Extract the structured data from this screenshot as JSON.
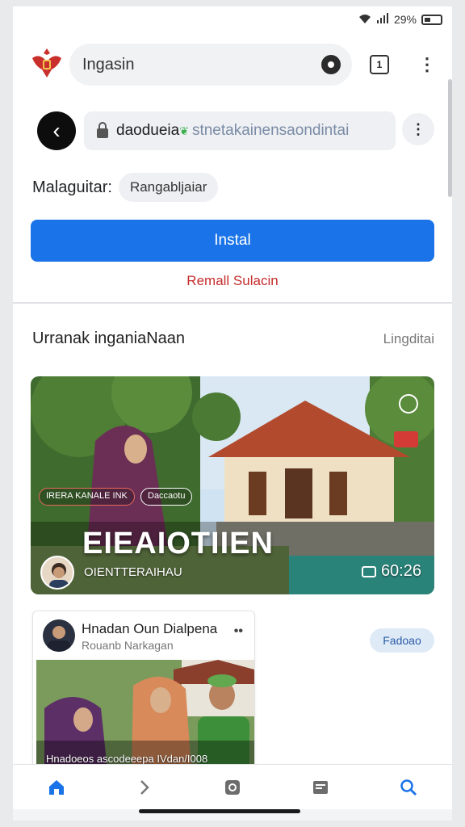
{
  "status_bar": {
    "battery": "29%"
  },
  "toolbar": {
    "search_text": "Ingasin",
    "tabs_count": "1",
    "crest_icon": "garuda-crest-icon"
  },
  "site_bar": {
    "url_host": "daodueia",
    "url_path": "stnetakainensaondintai"
  },
  "manage": {
    "label": "Malaguitar:",
    "chip": "Rangabljaiar"
  },
  "install_label": "Instal",
  "remove_label": "Remall Sulacin",
  "feed": {
    "title": "Urranak inganiaNaan",
    "link": "Lingditai"
  },
  "video": {
    "tag_1": "IRERA KANALE INK",
    "tag_2": "Daccaotu",
    "title": "EIEAIOTIIEN",
    "channel": "OIENTTERAIHAU",
    "duration": "60:26"
  },
  "post": {
    "name": "Hnadan Oun Dialpena",
    "subtitle": "Rouanb Narkagan",
    "more": "••",
    "caption": "Hnadoeos ascodeeepa IVdan/I008",
    "follow": "Fadoao"
  },
  "nav": [
    "home-icon",
    "forward-icon",
    "camera-icon",
    "reader-icon",
    "search-icon"
  ],
  "colors": {
    "accent": "#1a73e8",
    "danger": "#c62d2d"
  }
}
